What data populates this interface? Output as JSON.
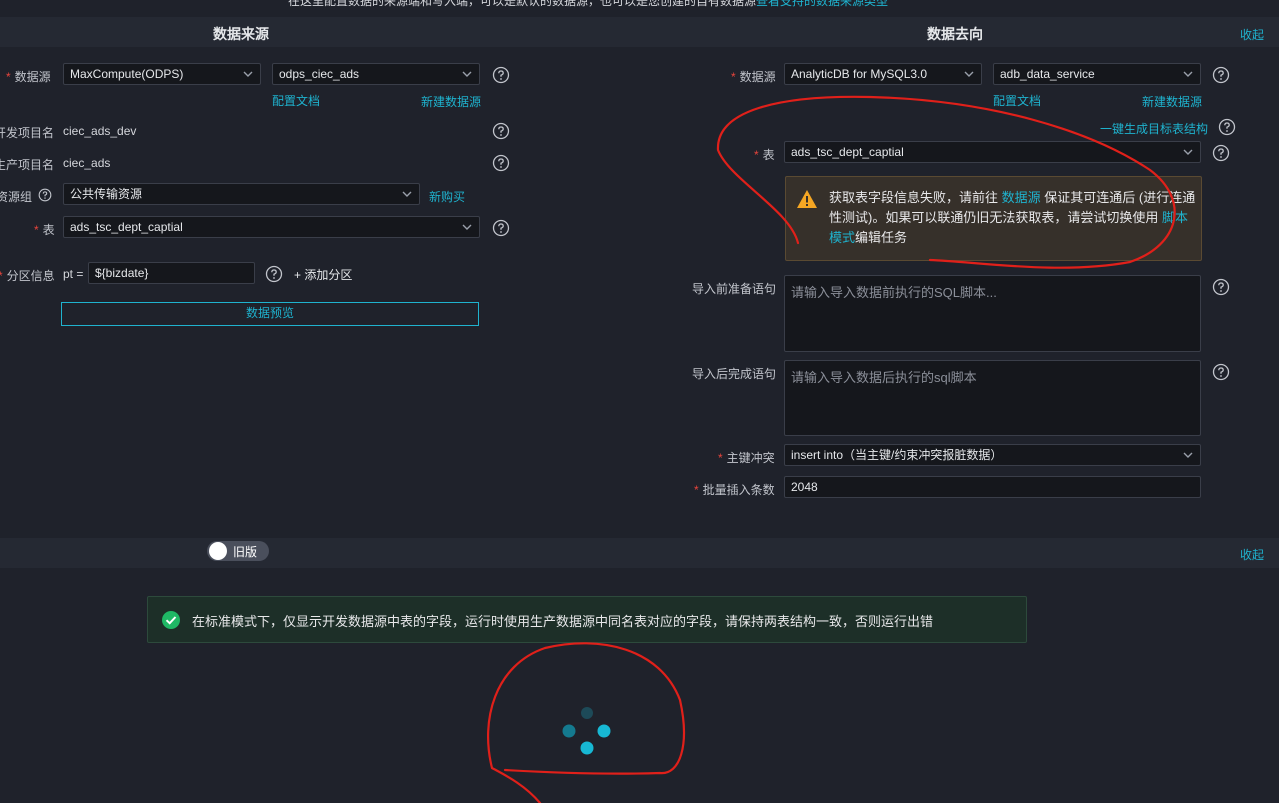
{
  "colors": {
    "accent": "#1fb3cf",
    "required": "#e8453c",
    "warning": "#f5a623",
    "success": "#1fb865",
    "annotation": "#e0201a"
  },
  "top_note": {
    "text": "在这里配置数据的来源端和写入端，可以是默认的数据源，也可以是您创建的自有数据源",
    "link": "查看支持的数据来源类型"
  },
  "source": {
    "title": "数据来源",
    "datasource_label": "数据源",
    "datasource_type": "MaxCompute(ODPS)",
    "datasource_name": "odps_ciec_ads",
    "config_doc": "配置文档",
    "new_datasource": "新建数据源",
    "dev_project_label": "开发项目名",
    "dev_project_value": "ciec_ads_dev",
    "prod_project_label": "生产项目名",
    "prod_project_value": "ciec_ads",
    "resource_group_label": "资源组",
    "resource_group_value": "公共传输资源",
    "buy_new": "新购买",
    "table_label": "表",
    "table_value": "ads_tsc_dept_captial",
    "partition_label": "分区信息",
    "partition_key": "pt =",
    "partition_value": "${bizdate}",
    "add_partition": "+ 添加分区",
    "preview_button": "数据预览"
  },
  "target": {
    "title": "数据去向",
    "collapse": "收起",
    "datasource_label": "数据源",
    "datasource_type": "AnalyticDB for MySQL3.0",
    "datasource_name": "adb_data_service",
    "config_doc": "配置文档",
    "new_datasource": "新建数据源",
    "gen_target_table": "一键生成目标表结构",
    "table_label": "表",
    "table_value": "ads_tsc_dept_captial",
    "warning": {
      "part1": "获取表字段信息失败，请前往 ",
      "link1": "数据源",
      "part2": " 保证其可连通后 (进行连通性测试)。如果可以联通仍旧无法获取表，请尝试切换使用 ",
      "link2": "脚本模式",
      "part3": "编辑任务"
    },
    "pre_sql_label": "导入前准备语句",
    "pre_sql_placeholder": "请输入导入数据前执行的SQL脚本...",
    "post_sql_label": "导入后完成语句",
    "post_sql_placeholder": "请输入导入数据后执行的sql脚本",
    "conflict_label": "主键冲突",
    "conflict_value": "insert into（当主键/约束冲突报脏数据）",
    "batch_label": "批量插入条数",
    "batch_value": "2048"
  },
  "mapping": {
    "toggle_label": "旧版",
    "collapse": "收起",
    "info_message": "在标准模式下，仅显示开发数据源中表的字段，运行时使用生产数据源中同名表对应的字段，请保持两表结构一致，否则运行出错"
  }
}
